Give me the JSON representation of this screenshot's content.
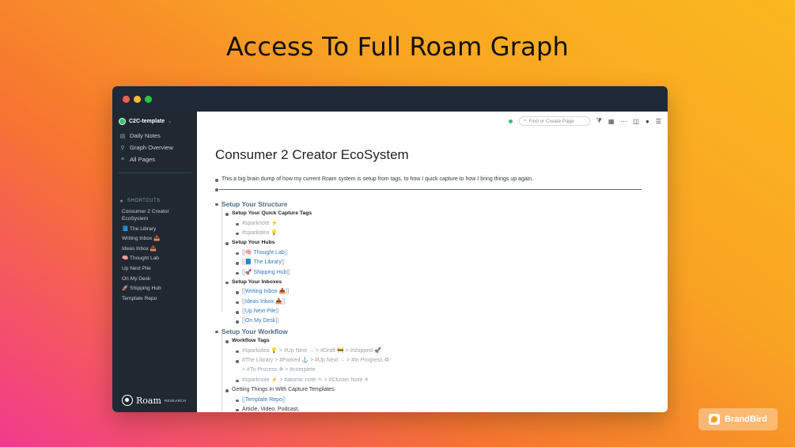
{
  "headline": "Access To Full Roam Graph",
  "sidebar": {
    "graph_name": "C2C-template",
    "nav": [
      {
        "icon": "calendar-icon",
        "glyph": "▤",
        "label": "Daily Notes"
      },
      {
        "icon": "graph-icon",
        "glyph": "⚲",
        "label": "Graph Overview"
      },
      {
        "icon": "list-icon",
        "glyph": "≡",
        "label": "All Pages"
      }
    ],
    "shortcuts_title": "SHORTCUTS",
    "shortcuts": [
      "Consumer 2 Creator EcoSystem",
      "📘 The Library",
      "Writing Inbox 📥",
      "Ideas Inbox 📥",
      "🧠 Thought Lab",
      "Up Next Pile",
      "On My Desk",
      "🚀 Shipping Hub",
      "Template Repo"
    ],
    "logo_word": "Roam",
    "logo_sub": "RESEARCH"
  },
  "toolbar": {
    "search_placeholder": "Find or Create Page"
  },
  "page": {
    "title": "Consumer 2 Creator EcoSystem",
    "intro": "This a big brain dump of how my current Roam system is setup from tags, to how I quick capture to how I bring things up again.",
    "setup_structure": "Setup Your Structure",
    "quick_capture_tags": "Setup Your Quick Capture Tags",
    "tag_sparknote": "#sparknote ⚡",
    "tag_sparkidea": "#sparkidea 💡",
    "setup_hubs": "Setup Your Hubs",
    "hub_thought_lab": "🧠 Thought Lab",
    "hub_library": "📘 The Library",
    "hub_shipping": "🚀 Shipping Hub",
    "setup_inboxes": "Setup Your Inboxes",
    "inbox_writing": "Writing Inbox 📥",
    "inbox_ideas": "Ideas Inbox 📥",
    "inbox_upnext": "Up Next Pile",
    "inbox_desk": "On My Desk",
    "setup_workflow": "Setup Your Workflow",
    "workflow_tags": "Workflow Tags",
    "wf_line1": "#sparkidea 💡 > #Up Next → > #Draft 🚧 > #shipped 🚀",
    "wf_line2a": "#The Library > #Parked ⚓ > #Up Next → > #In Progress ♻",
    "wf_line2b": "> #To Process ❄ > #complete",
    "wf_line3": "#sparknote ⚡ > #atomic note ⚛ > #Cluster Note ✳",
    "getting_things": "Getting Things In With Capture Templates",
    "template_repo": "Template Repo",
    "article_line": "Article, Video, Podcast,"
  },
  "brand": "BrandBird"
}
